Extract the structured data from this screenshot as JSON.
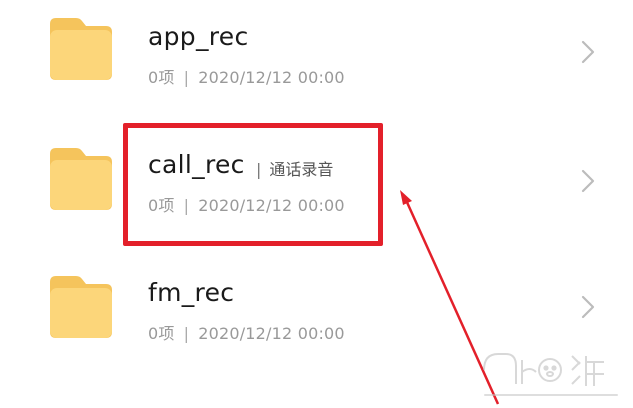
{
  "folders": [
    {
      "name": "app_rec",
      "tag": "",
      "count": "0项",
      "separator": "|",
      "date": "2020/12/12 00:00"
    },
    {
      "name": "call_rec",
      "tag": "通话录音",
      "count": "0项",
      "separator": "|",
      "date": "2020/12/12 00:00"
    },
    {
      "name": "fm_rec",
      "tag": "",
      "count": "0项",
      "separator": "|",
      "date": "2020/12/12 00:00"
    }
  ],
  "tag_separator": "|",
  "colors": {
    "folder": "#fcd67a",
    "folder_shade": "#f5c45c",
    "highlight": "#e3202a",
    "chevron": "#bcbcbc"
  },
  "icons": {
    "folder": "folder-icon",
    "chevron": "chevron-right-icon",
    "arrow": "arrow-icon",
    "watermark": "baidu-jingyan-watermark"
  }
}
